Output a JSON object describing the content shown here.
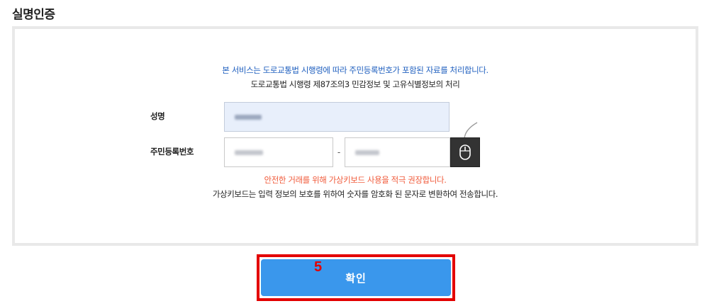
{
  "page": {
    "section_title": "실명인증"
  },
  "notice": {
    "line1": "본 서비스는 도로교통법 시행령에 따라 주민등록번호가 포함된 자료를 처리합니다.",
    "line2": "도로교통법 시행령 제87조의3 민감정보 및 고유식별정보의 처리"
  },
  "form": {
    "name_label": "성명",
    "rrn_label": "주민등록번호",
    "rrn_separator": "-",
    "virtual_keyboard_icon": "mouse-icon"
  },
  "warning": {
    "line1": "안전한 거래를 위해 가상키보드 사용을 적극 권장합니다.",
    "line2": "가상키보드는 입력 정보의 보호를 위하여 숫자를 암호화 된 문자로 변환하여 전송합니다."
  },
  "actions": {
    "confirm_label": "확인",
    "step_marker": "5"
  },
  "colors": {
    "notice_blue": "#1f5fbf",
    "warning_orange": "#f05a3a",
    "button_blue": "#3a97ec",
    "highlight_red": "#e30000",
    "name_field_bg": "#e8effb"
  }
}
